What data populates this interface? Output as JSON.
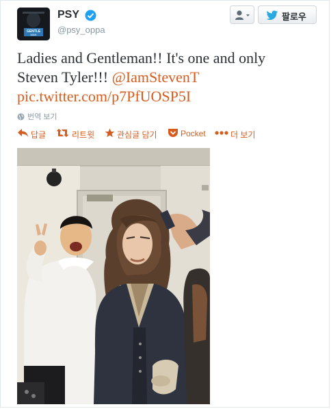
{
  "profile": {
    "name": "PSY",
    "handle": "@psy_oppa",
    "avatar_text_top": "GENTLE",
    "avatar_text_bottom": "MAN"
  },
  "buttons": {
    "follow_label": "팔로우"
  },
  "tweet": {
    "line1": "Ladies and Gentleman!! It's one and only",
    "line2_text": "Steven Tyler!!! ",
    "mention": "@IamStevenT",
    "pic_link": "pic.twitter.com/p7PfUOSP5I",
    "translate_label": "번역 보기"
  },
  "actions": {
    "reply": "답글",
    "retweet": "리트윗",
    "favorite": "관심글 담기",
    "pocket": "Pocket",
    "more": "더 보기"
  },
  "colors": {
    "link": "#d65c1e",
    "verified": "#1da1f2",
    "follow_bird": "#2aa9e0"
  }
}
